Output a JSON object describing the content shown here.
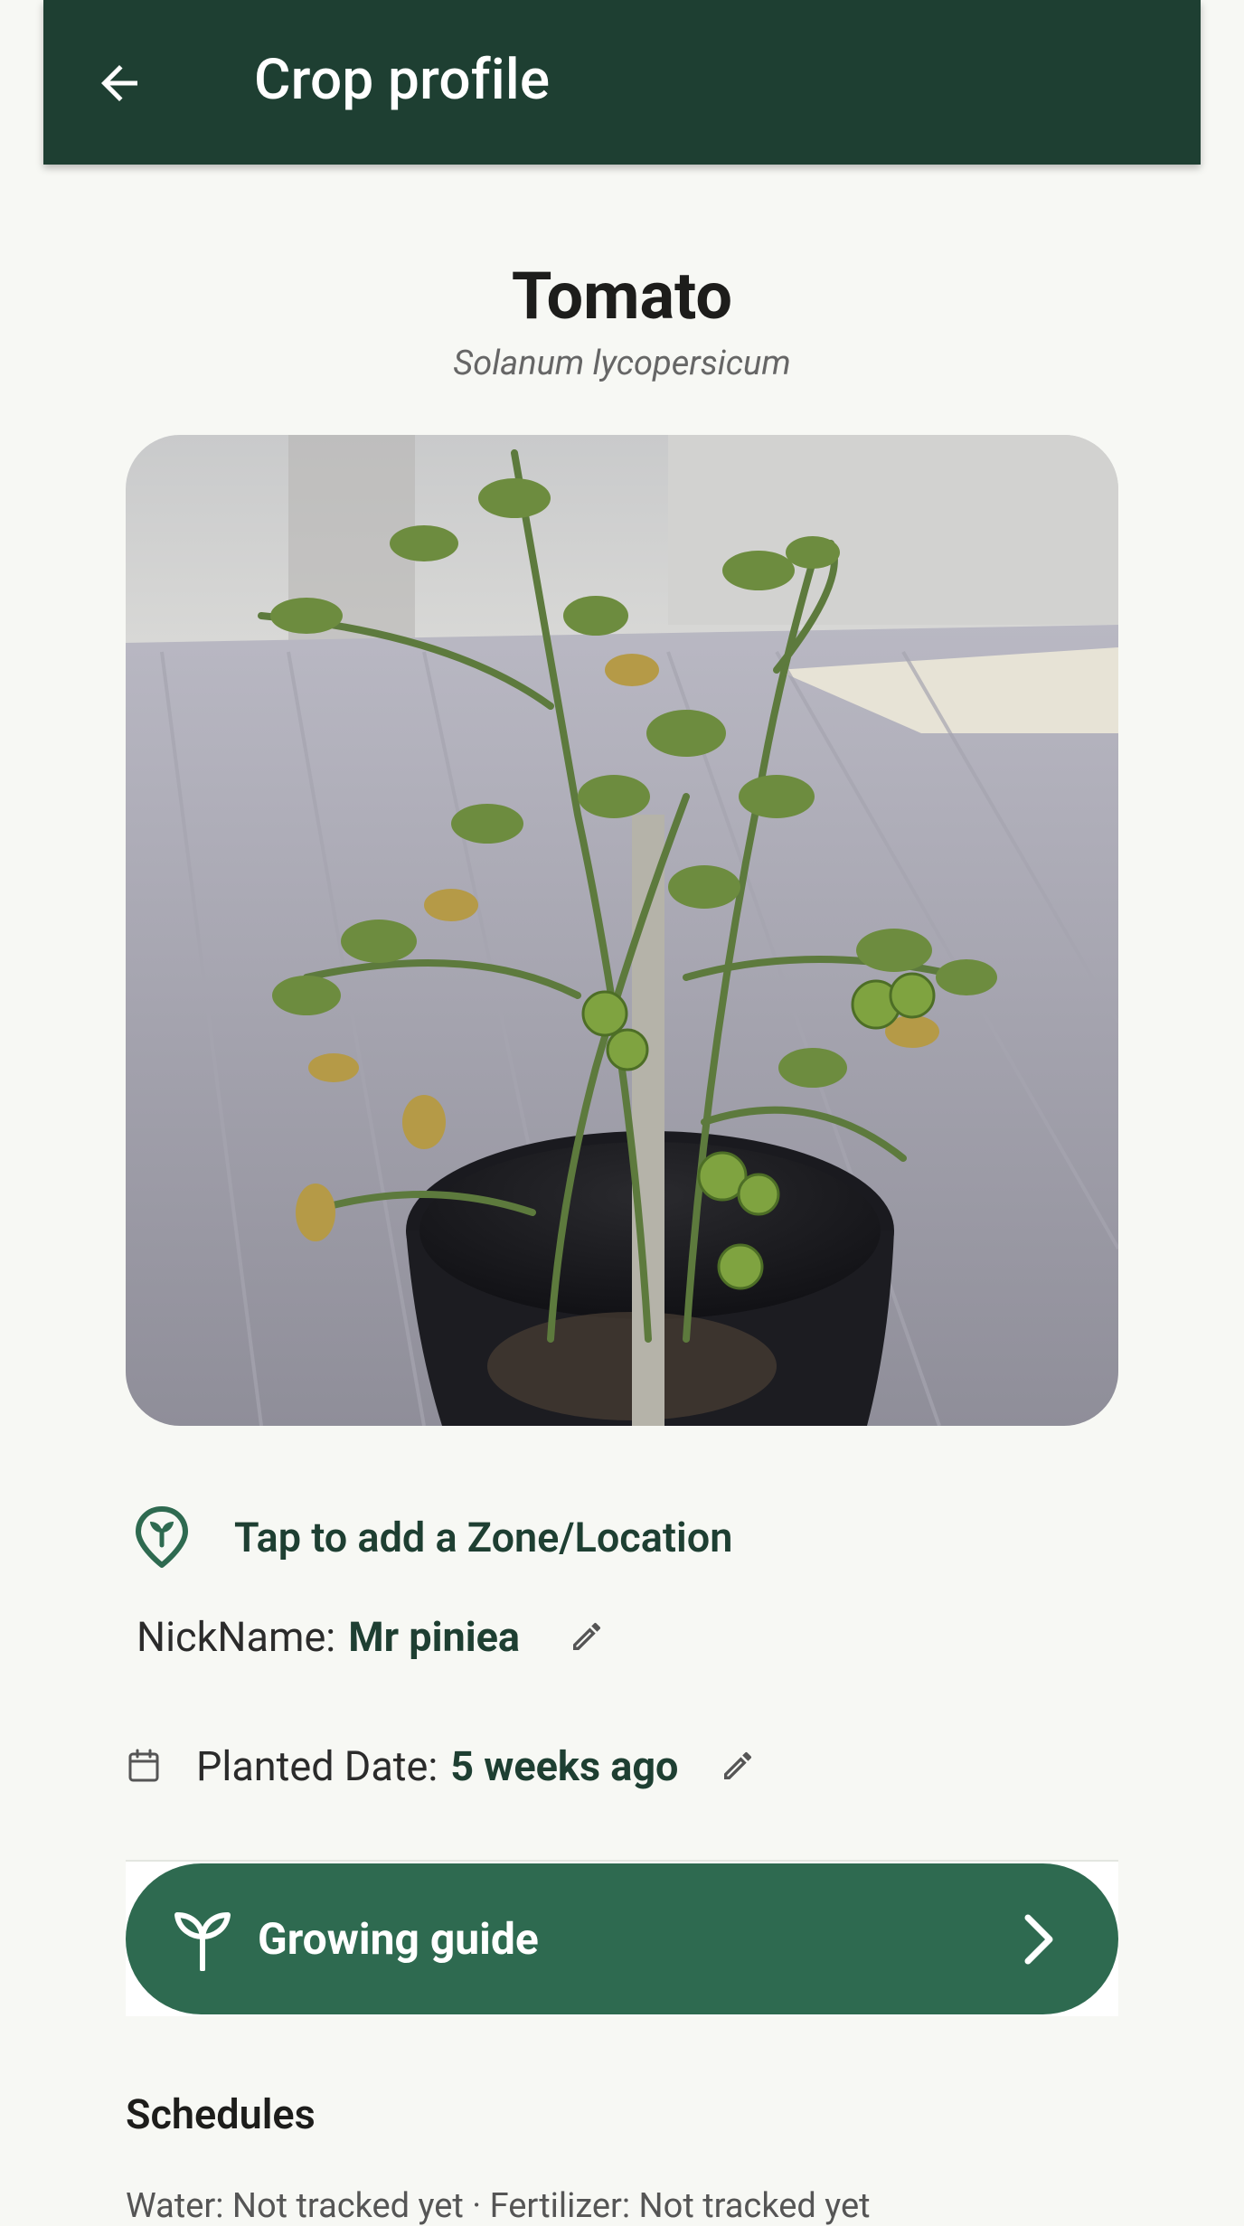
{
  "appbar": {
    "title": "Crop profile",
    "back_icon": "arrow-left-icon",
    "background": "#1e3f32"
  },
  "crop": {
    "name": "Tomato",
    "latin_name": "Solanum lycopersicum",
    "photo_subject": "tomato-plant-in-pot"
  },
  "location": {
    "label": "Tap to add a Zone/Location",
    "icon": "location-pin-sprout-icon"
  },
  "nickname": {
    "label": "NickName:",
    "value": "Mr piniea",
    "edit_icon": "pencil-icon"
  },
  "planted": {
    "label": "Planted Date:",
    "value": "5 weeks ago",
    "icon": "calendar-icon",
    "edit_icon": "pencil-icon"
  },
  "guide": {
    "label": "Growing guide",
    "icon": "sprout-icon",
    "chevron": "chevron-right-icon",
    "color": "#2e6a50"
  },
  "schedules": {
    "title": "Schedules",
    "summary": "Water: Not tracked yet · Fertilizer: Not tracked yet"
  }
}
